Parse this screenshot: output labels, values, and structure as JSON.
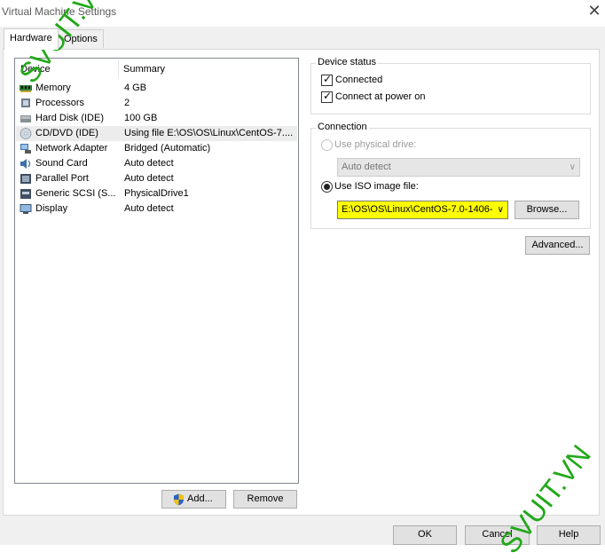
{
  "window": {
    "title": "Virtual Machine Settings"
  },
  "tabs": [
    {
      "label": "Hardware"
    },
    {
      "label": "Options"
    }
  ],
  "device_list": {
    "headers": {
      "device": "Device",
      "summary": "Summary"
    },
    "rows": [
      {
        "device": "Memory",
        "summary": "4 GB",
        "icon": "memory-icon"
      },
      {
        "device": "Processors",
        "summary": "2",
        "icon": "processor-icon"
      },
      {
        "device": "Hard Disk (IDE)",
        "summary": "100 GB",
        "icon": "hard-disk-icon"
      },
      {
        "device": "CD/DVD (IDE)",
        "summary": "Using file E:\\OS\\OS\\Linux\\CentOS-7....",
        "icon": "cd-dvd-icon",
        "selected": true
      },
      {
        "device": "Network Adapter",
        "summary": "Bridged (Automatic)",
        "icon": "network-adapter-icon"
      },
      {
        "device": "Sound Card",
        "summary": "Auto detect",
        "icon": "sound-card-icon"
      },
      {
        "device": "Parallel Port",
        "summary": "Auto detect",
        "icon": "parallel-port-icon"
      },
      {
        "device": "Generic SCSI (S...",
        "summary": "PhysicalDrive1",
        "icon": "scsi-icon"
      },
      {
        "device": "Display",
        "summary": "Auto detect",
        "icon": "display-icon"
      }
    ]
  },
  "list_buttons": {
    "add": "Add...",
    "remove": "Remove"
  },
  "device_status": {
    "label": "Device status",
    "connected": {
      "label": "Connected",
      "checked": true
    },
    "connect_power_on": {
      "label": "Connect at power on",
      "checked": true
    }
  },
  "connection": {
    "label": "Connection",
    "physical": {
      "label": "Use physical drive:",
      "selected": false,
      "enabled": false
    },
    "physical_combo": {
      "value": "Auto detect"
    },
    "iso": {
      "label": "Use ISO image file:",
      "selected": true
    },
    "iso_path": {
      "value": "E:\\OS\\OS\\Linux\\CentOS-7.0-1406-"
    },
    "browse": "Browse...",
    "advanced": "Advanced..."
  },
  "footer": {
    "ok": "OK",
    "cancel": "Cancel",
    "help": "Help"
  },
  "watermark": "SVUIT.VN",
  "colors": {
    "highlight": "#ffff00",
    "watermark": "#21a818"
  }
}
